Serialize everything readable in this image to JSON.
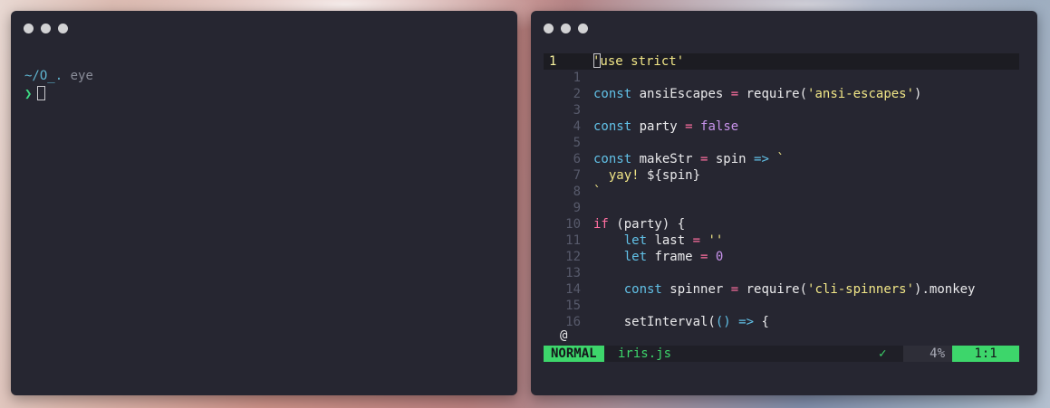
{
  "left_terminal": {
    "path": "~/O_.",
    "path_suffix": " eye",
    "prompt_symbol": "❯"
  },
  "editor": {
    "lines": [
      {
        "n": "1"
      },
      {
        "n": "1"
      },
      {
        "n": "2"
      },
      {
        "n": "3"
      },
      {
        "n": "4"
      },
      {
        "n": "5"
      },
      {
        "n": "6"
      },
      {
        "n": "7"
      },
      {
        "n": "8"
      },
      {
        "n": "9"
      },
      {
        "n": "10"
      },
      {
        "n": "11"
      },
      {
        "n": "12"
      },
      {
        "n": "13"
      },
      {
        "n": "14"
      },
      {
        "n": "15"
      },
      {
        "n": "16"
      }
    ],
    "text": {
      "l0_str": "'use strict'",
      "l2_const": "const",
      "l2_name": " ansiEscapes ",
      "l2_eq": "=",
      "l2_req": " require(",
      "l2_arg": "'ansi-escapes'",
      "l2_close": ")",
      "l4_const": "const",
      "l4_name": " party ",
      "l4_eq": "=",
      "l4_val": "false",
      "l6_const": "const",
      "l6_name": " makeStr ",
      "l6_eq": "=",
      "l6_param": " spin ",
      "l6_arrow": "=>",
      "l6_tick": " `",
      "l7_indent": "  ",
      "l7_yay": "yay!",
      "l7_tmpl": " ${spin}",
      "l8_tick": "`",
      "l10_if": "if",
      "l10_rest": " (party) {",
      "l11_indent": "    ",
      "l11_let": "let",
      "l11_name": " last ",
      "l11_eq": "=",
      "l11_val": " ''",
      "l12_indent": "    ",
      "l12_let": "let",
      "l12_name": " frame ",
      "l12_eq": "=",
      "l12_val": " 0",
      "l14_indent": "    ",
      "l14_const": "const",
      "l14_name": " spinner ",
      "l14_eq": "=",
      "l14_req": " require(",
      "l14_arg": "'cli-spinners'",
      "l14_close": ").monkey",
      "l16_indent": "    ",
      "l16_fn": "setInterval(",
      "l16_parens": "()",
      "l16_arrow": " =>",
      "l16_brace": " {"
    },
    "at_symbol": "@"
  },
  "statusbar": {
    "mode": "NORMAL",
    "filename": "iris.js",
    "check": "✓",
    "percent": "4%",
    "position": "1:1"
  }
}
